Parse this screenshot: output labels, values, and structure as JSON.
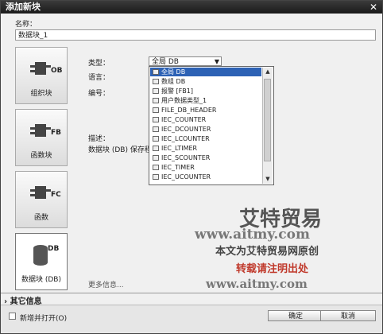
{
  "window": {
    "title": "添加新块",
    "close": "✕"
  },
  "name": {
    "label": "名称：",
    "value": "数据块_1"
  },
  "tiles": [
    {
      "tag": "OB",
      "caption": "组织块"
    },
    {
      "tag": "FB",
      "caption": "函数块"
    },
    {
      "tag": "FC",
      "caption": "函数"
    },
    {
      "tag": "DB",
      "caption": "数据块 (DB)"
    }
  ],
  "props": {
    "type_label": "类型：",
    "language_label": "语言：",
    "number_label": "编号：",
    "desc_label": "描述：",
    "desc_text": "数据块 (DB) 保存程序",
    "more_label": "更多信息...",
    "type_value": "全局 DB"
  },
  "dropdown": {
    "items": [
      "全局 DB",
      "数组 DB",
      "报警 [FB1]",
      "用户数据类型_1",
      "FILE_DB_HEADER",
      "IEC_COUNTER",
      "IEC_DCOUNTER",
      "IEC_LCOUNTER",
      "IEC_LTIMER",
      "IEC_SCOUNTER",
      "IEC_TIMER",
      "IEC_UCOUNTER"
    ],
    "selected_index": 0
  },
  "section": {
    "label": "其它信息"
  },
  "footer": {
    "checkbox_label": "新增并打开(O)",
    "ok": "确定",
    "cancel": "取消"
  },
  "watermark": {
    "brand": "艾特贸易",
    "url1": "www.aitmy.com",
    "line1": "本文为艾特贸易网原创",
    "line2": "转载请注明出处",
    "url2": "www.aitmy.com"
  }
}
